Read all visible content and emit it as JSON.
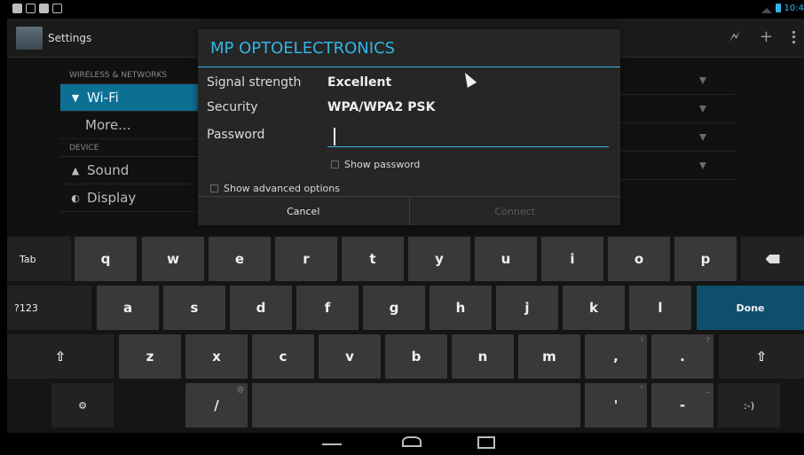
{
  "status_bar": {
    "time": "10:4"
  },
  "action_bar": {
    "title": "Settings"
  },
  "settings": {
    "headers": {
      "wireless": "WIRELESS & NETWORKS",
      "device": "DEVICE"
    },
    "items": [
      {
        "label": "Wi-Fi",
        "icon": "wifi-icon"
      },
      {
        "label": "More..."
      },
      {
        "label": "Sound",
        "icon": "speaker-icon"
      },
      {
        "label": "Display",
        "icon": "brightness-icon"
      }
    ]
  },
  "dialog": {
    "title": "MP OPTOELECTRONICS",
    "signal_label": "Signal strength",
    "signal_value": "Excellent",
    "security_label": "Security",
    "security_value": "WPA/WPA2 PSK",
    "password_label": "Password",
    "password_value": "",
    "show_password": "Show password",
    "show_advanced": "Show advanced options",
    "cancel": "Cancel",
    "connect": "Connect"
  },
  "keyboard": {
    "row1": [
      "Tab",
      "q",
      "w",
      "e",
      "r",
      "t",
      "y",
      "u",
      "i",
      "o",
      "p"
    ],
    "row2": [
      "?123",
      "a",
      "s",
      "d",
      "f",
      "g",
      "h",
      "j",
      "k",
      "l",
      "Done"
    ],
    "row3": [
      "z",
      "x",
      "c",
      "v",
      "b",
      "n",
      "m",
      ",",
      "."
    ],
    "row3_hints": [
      "!",
      "?"
    ],
    "row4": {
      "settings": "⚙",
      "slash": "/",
      "slash_hint": "@",
      "apostrophe": "'",
      "apostrophe_hint": "\"",
      "dash": "-",
      "dash_hint": "_",
      "smiley": ":-)"
    }
  },
  "colors": {
    "accent": "#33b5e5",
    "selected_item": "#0d6f94",
    "done_key": "#0e4f6d"
  }
}
